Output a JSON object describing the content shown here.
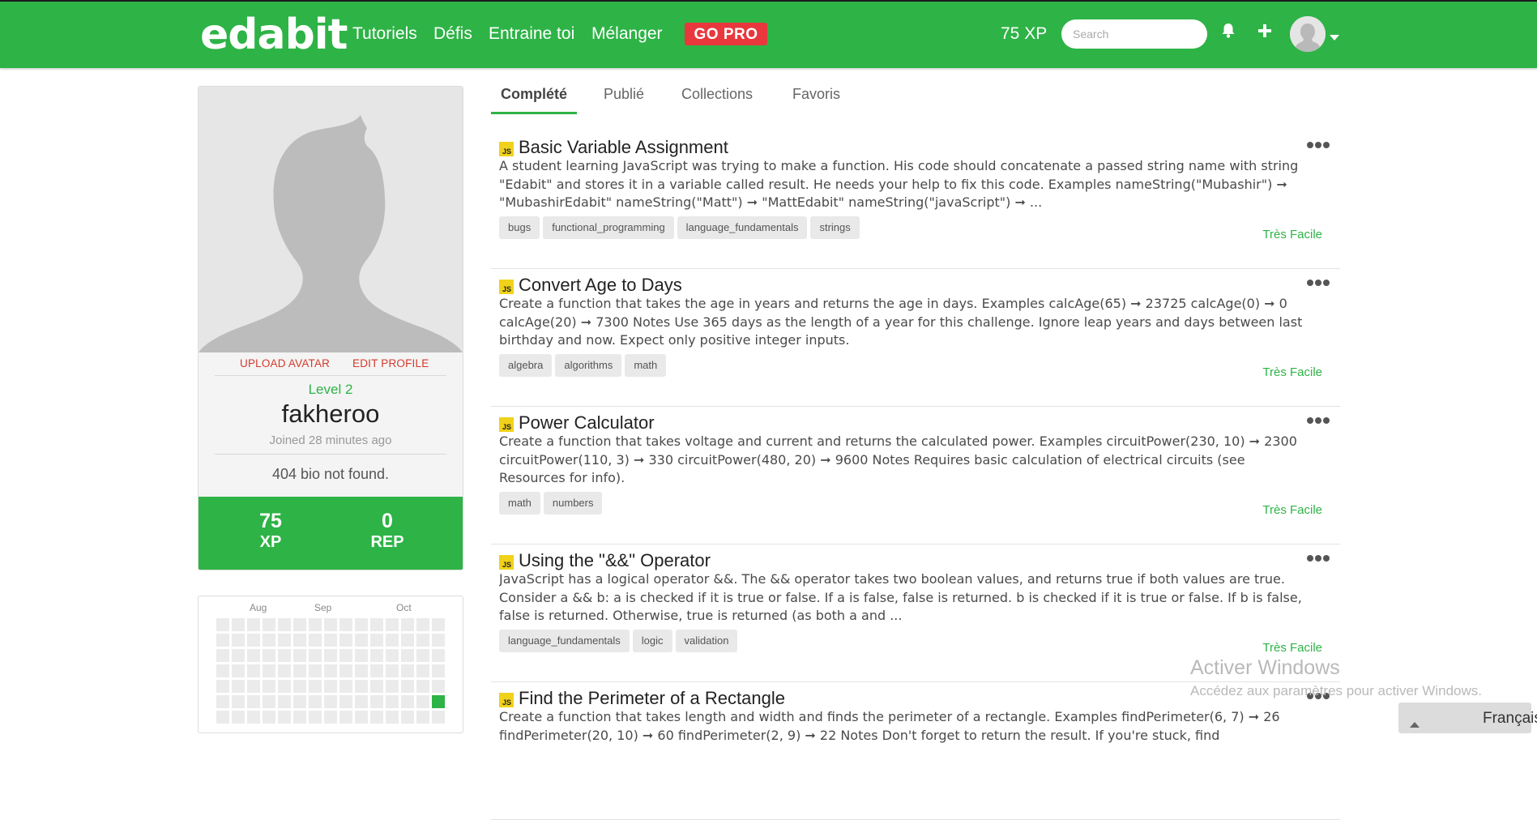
{
  "navbar": {
    "brand": "edabit",
    "links": [
      "Tutoriels",
      "Défis",
      "Entraine toi",
      "Mélanger"
    ],
    "go_pro": "GO PRO",
    "xp": "75 XP",
    "search_placeholder": "Search",
    "icons": [
      "bell-icon",
      "plus-icon",
      "avatar",
      "caret-down-icon"
    ]
  },
  "profile": {
    "upload_avatar": "UPLOAD AVATAR",
    "edit_profile": "EDIT PROFILE",
    "level": "Level 2",
    "username": "fakheroo",
    "joined": "Joined 28 minutes ago",
    "bio": "404 bio not found.",
    "stats": [
      {
        "value": "75",
        "label": "XP"
      },
      {
        "value": "0",
        "label": "REP"
      }
    ]
  },
  "calendar": {
    "months": [
      "Aug",
      "Sep",
      "Oct"
    ],
    "active_color": "#2eb346"
  },
  "tabs": [
    "Complété",
    "Publié",
    "Collections",
    "Favoris"
  ],
  "active_tab": "Complété",
  "challenges": [
    {
      "language": "JS",
      "title": "Basic Variable Assignment",
      "description": "A student learning JavaScript was trying to make a function. His code should concatenate a passed string name with string \"Edabit\" and stores it in a variable called result. He needs your help to fix this code. Examples nameString(\"Mubashir\") ➞ \"MubashirEdabit\" nameString(\"Matt\") ➞ \"MattEdabit\" nameString(\"javaScript\") ➞ ...",
      "tags": [
        "bugs",
        "functional_programming",
        "language_fundamentals",
        "strings"
      ],
      "difficulty": "Très Facile"
    },
    {
      "language": "JS",
      "title": "Convert Age to Days",
      "description": "Create a function that takes the age in years and returns the age in days. Examples calcAge(65) ➞ 23725 calcAge(0) ➞ 0 calcAge(20) ➞ 7300 Notes Use 365 days as the length of a year for this challenge. Ignore leap years and days between last birthday and now. Expect only positive integer inputs.",
      "tags": [
        "algebra",
        "algorithms",
        "math"
      ],
      "difficulty": "Très Facile"
    },
    {
      "language": "JS",
      "title": "Power Calculator",
      "description": "Create a function that takes voltage and current and returns the calculated power. Examples circuitPower(230, 10) ➞ 2300 circuitPower(110, 3) ➞ 330 circuitPower(480, 20) ➞ 9600 Notes Requires basic calculation of electrical circuits (see Resources for info).",
      "tags": [
        "math",
        "numbers"
      ],
      "difficulty": "Très Facile"
    },
    {
      "language": "JS",
      "title": "Using the \"&&\" Operator",
      "description": "JavaScript has a logical operator &&. The && operator takes two boolean values, and returns true if both values are true. Consider a && b: a is checked if it is true or false. If a is false, false is returned. b is checked if it is true or false. If b is false, false is returned. Otherwise, true is returned (as both a and ...",
      "tags": [
        "language_fundamentals",
        "logic",
        "validation"
      ],
      "difficulty": "Très Facile"
    },
    {
      "language": "JS",
      "title": "Find the Perimeter of a Rectangle",
      "description": "Create a function that takes length and width and finds the perimeter of a rectangle. Examples findPerimeter(6, 7) ➞ 26 findPerimeter(20, 10) ➞ 60 findPerimeter(2, 9) ➞ 22 Notes Don't forget to return the result. If you're stuck, find",
      "tags": [],
      "difficulty": ""
    }
  ],
  "watermark": {
    "line1": "Activer Windows",
    "line2": "Accédez aux paramètres pour activer Windows."
  },
  "language_selector": "Français",
  "colors": {
    "brand": "#2eb346",
    "go_pro": "#e8383d",
    "js_badge": "#f0d21b",
    "danger_link": "#d33a2c"
  }
}
